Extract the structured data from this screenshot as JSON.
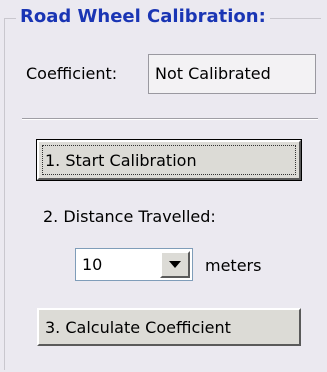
{
  "group": {
    "title": "Road Wheel Calibration:"
  },
  "coefficient": {
    "label": "Coefficient:",
    "value": "Not Calibrated"
  },
  "start_button": {
    "label": "1. Start Calibration"
  },
  "distance": {
    "label": "2. Distance Travelled:",
    "selected": "10",
    "unit": "meters"
  },
  "calculate_button": {
    "label": "3. Calculate Coefficient"
  },
  "icons": {
    "dropdown": "chevron-down-icon"
  },
  "colors": {
    "title": "#1a35b4",
    "background": "#ebe9f0",
    "button_face": "#dcdbd6"
  }
}
